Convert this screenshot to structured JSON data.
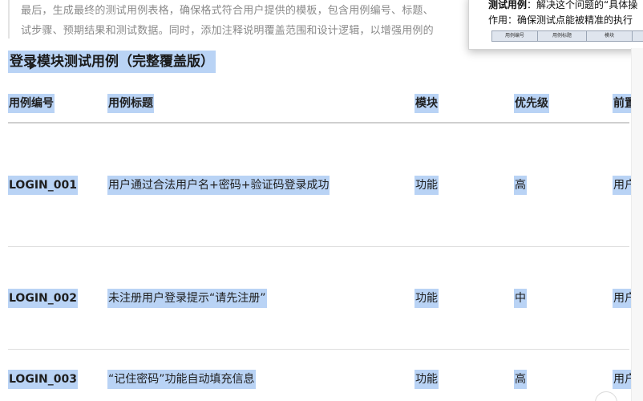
{
  "intro": {
    "line1": "最后，生成最终的测试用例表格，确保格式符合用户提供的模板，包含用例编号、标题、",
    "line2": "试步骤、预期结果和测试数据。同时，添加注释说明覆盖范围和设计逻辑，以增强用例的"
  },
  "popup": {
    "line1_label": "测试用例",
    "line1_text": "：解决这个问题的“具体操",
    "line2": "作用：确保测试点能被精准的执行",
    "thumb_columns": [
      "用例编号",
      "用例标题",
      "模块",
      ""
    ]
  },
  "heading": "登录模块测试用例（完整覆盖版）",
  "table": {
    "headers": [
      "用例编号",
      "用例标题",
      "模块",
      "优先级",
      "前置"
    ],
    "rows": [
      {
        "id": "LOGIN_001",
        "title": "用户通过合法用户名+密码+验证码登录成功",
        "module": "功能",
        "priority": "高",
        "pre": "用户"
      },
      {
        "id": "LOGIN_002",
        "title": "未注册用户登录提示“请先注册”",
        "module": "功能",
        "priority": "中",
        "pre": "用户"
      },
      {
        "id": "LOGIN_003",
        "title": "“记住密码”功能自动填充信息",
        "module": "功能",
        "priority": "高",
        "pre": "用户"
      }
    ]
  },
  "colors": {
    "selection": "#b9d3f5",
    "muted_text": "#8a8a8a"
  }
}
